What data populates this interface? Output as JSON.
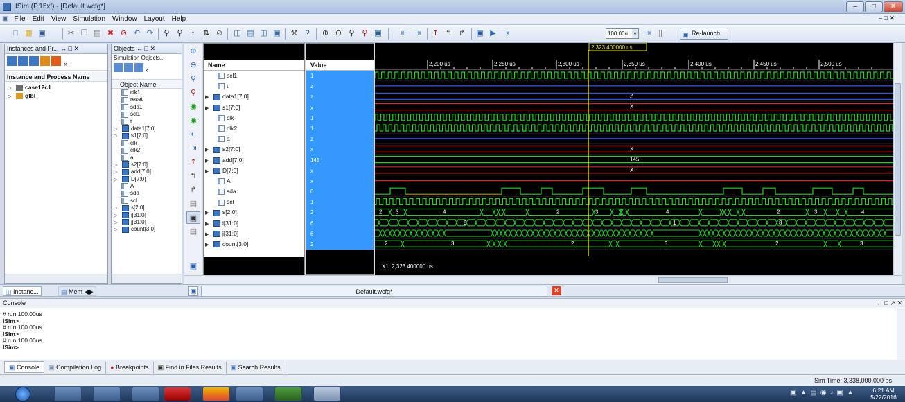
{
  "window": {
    "title": "ISim (P.15xf) - [Default.wcfg*]"
  },
  "menu": [
    "File",
    "Edit",
    "View",
    "Simulation",
    "Window",
    "Layout",
    "Help"
  ],
  "toolbar": {
    "zoom_value": "100.00u",
    "relaunch_label": "Re-launch"
  },
  "instances_panel": {
    "title": "Instances and Pr...",
    "column_header": "Instance and Process Name",
    "items": [
      "case12c1",
      "glbl"
    ],
    "tabs": [
      "Instanc...",
      "Mem"
    ]
  },
  "objects_panel": {
    "title": "Objects",
    "subtitle": "Simulation Objects...",
    "column_header": "Object Name",
    "items": [
      "clk1",
      "reset",
      "sda1",
      "scl1",
      "t",
      "data1[7:0]",
      "s1[7:0]",
      "clk",
      "clk2",
      "a",
      "s2[7:0]",
      "add[7:0]",
      "D[7:0]",
      "A",
      "sda",
      "scl",
      "s[2:0]",
      "i[31:0]",
      "j[31:0]",
      "count[3:0]"
    ]
  },
  "wave_names": {
    "name_header": "Name",
    "value_header": "Value",
    "rows": [
      {
        "name": "scl1",
        "value": "1",
        "bus": false
      },
      {
        "name": "t",
        "value": "z",
        "bus": false
      },
      {
        "name": "data1[7:0]",
        "value": "z",
        "bus": true
      },
      {
        "name": "s1[7:0]",
        "value": "x",
        "bus": true
      },
      {
        "name": "clk",
        "value": "1",
        "bus": false
      },
      {
        "name": "clk2",
        "value": "1",
        "bus": false
      },
      {
        "name": "a",
        "value": "z",
        "bus": false
      },
      {
        "name": "s2[7:0]",
        "value": "x",
        "bus": true
      },
      {
        "name": "add[7:0]",
        "value": "145",
        "bus": true
      },
      {
        "name": "D[7:0]",
        "value": "x",
        "bus": true
      },
      {
        "name": "A",
        "value": "x",
        "bus": false
      },
      {
        "name": "sda",
        "value": "0",
        "bus": false
      },
      {
        "name": "scl",
        "value": "1",
        "bus": false
      },
      {
        "name": "s[2:0]",
        "value": "2",
        "bus": true
      },
      {
        "name": "i[31:0]",
        "value": "6",
        "bus": true
      },
      {
        "name": "j[31:0]",
        "value": "6",
        "bus": true
      },
      {
        "name": "count[3:0]",
        "value": "2",
        "bus": true
      }
    ]
  },
  "waveform": {
    "cursor_label": "2,323.400000 us",
    "time_ticks": [
      "2,200 us",
      "2,250 us",
      "2,300 us",
      "2,350 us",
      "2,400 us",
      "2,450 us",
      "2,500 us"
    ],
    "bus_labels": {
      "data1": "Z",
      "s1": "X",
      "s2": "X",
      "add": "145",
      "D": "X"
    },
    "s_labels": [
      "2",
      "3",
      "4",
      "2",
      "3",
      "4",
      "2",
      "3",
      "4"
    ],
    "count_labels": [
      "2",
      "3",
      "2",
      "3",
      "2",
      "3"
    ],
    "i_labels": [
      "8",
      "1",
      "8"
    ],
    "x1_label": "X1: 2,323.400000 us",
    "tab_label": "Default.wcfg*"
  },
  "console": {
    "title": "Console",
    "lines": [
      "# run 100.00us",
      "ISim>",
      "# run 100.00us",
      "ISim>",
      "# run 100.00us",
      "ISim>"
    ],
    "tabs": [
      "Console",
      "Compilation Log",
      "Breakpoints",
      "Find in Files Results",
      "Search Results"
    ]
  },
  "status": {
    "sim_time": "Sim Time: 3,338,000,000 ps"
  },
  "taskbar": {
    "time": "6:21 AM",
    "date": "5/22/2016"
  },
  "colors": {
    "wave_green": "#22d322",
    "wave_red": "#e02020",
    "wave_blue": "#2b4bff",
    "cursor": "#e6e600",
    "value_bg": "#3399ff"
  }
}
